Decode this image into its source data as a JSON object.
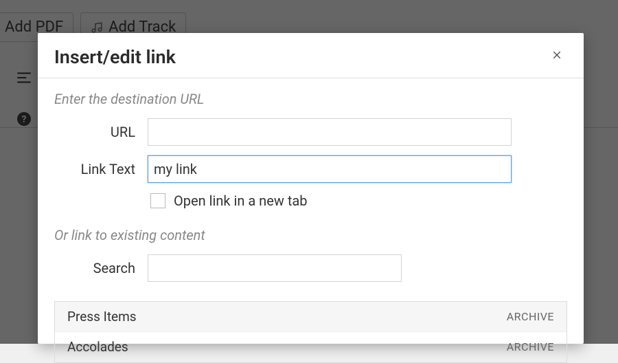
{
  "background": {
    "add_pdf_label": "Add PDF",
    "add_track_label": "Add Track"
  },
  "dialog": {
    "title": "Insert/edit link",
    "section_url": "Enter the destination URL",
    "url_label": "URL",
    "url_value": "",
    "link_text_label": "Link Text",
    "link_text_value": "my link",
    "new_tab_label": "Open link in a new tab",
    "section_existing": "Or link to existing content",
    "search_label": "Search",
    "search_value": "",
    "results": [
      {
        "title": "Press Items",
        "type": "ARCHIVE"
      },
      {
        "title": "Accolades",
        "type": "ARCHIVE"
      }
    ]
  }
}
